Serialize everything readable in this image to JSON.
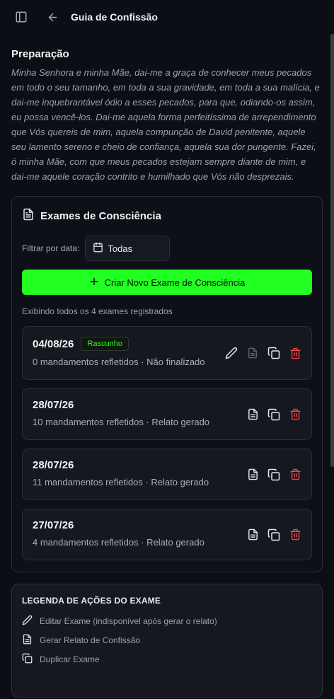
{
  "header": {
    "title": "Guia de Confissão"
  },
  "preparation": {
    "title": "Preparação",
    "prayer": "Minha Senhora e minha Mãe, dai-me a graça de conhecer meus pecados em todo o seu tamanho, em toda a sua gravidade, em toda a sua malícia, e dai-me inquebrantável ódio a esses pecados, para que, odiando-os assim, eu possa vencê-los. Dai-me aquela forma perfeitíssima de arrependimento que Vós quereis de mim, aquela compunção de David penitente, aquele seu lamento sereno e cheio de confiança, aquela sua dor pungente. Fazei, ó minha Mãe, com que meus pecados estejam sempre diante de mim, e dai-me aquele coração contrito e humilhado que Vós não desprezais."
  },
  "exams_card": {
    "title": "Exames de Consciência",
    "filter_label": "Filtrar por data:",
    "filter_value": "Todas",
    "create_label": "Criar Novo Exame de Consciência",
    "summary": "Exibindo todos os 4 exames registrados",
    "exams": [
      {
        "date": "04/08/26",
        "badge": "Rascunho",
        "meta": "0 mandamentos refletidos · Não finalizado"
      },
      {
        "date": "28/07/26",
        "meta": "10 mandamentos refletidos · Relato gerado"
      },
      {
        "date": "28/07/26",
        "meta": "11 mandamentos refletidos · Relato gerado"
      },
      {
        "date": "27/07/26",
        "meta": "4 mandamentos refletidos · Relato gerado"
      }
    ]
  },
  "legend": {
    "title": "LEGENDA DE AÇÕES DO EXAME",
    "items": [
      {
        "icon": "pencil-icon",
        "label": "Editar Exame (indisponível após gerar o relato)"
      },
      {
        "icon": "file-text-icon",
        "label": "Gerar Relato de Confissão"
      },
      {
        "icon": "copy-icon",
        "label": "Duplicar Exame"
      }
    ]
  },
  "colors": {
    "accent": "#22ff22",
    "danger": "#ef4444",
    "background": "#0b0e14"
  }
}
